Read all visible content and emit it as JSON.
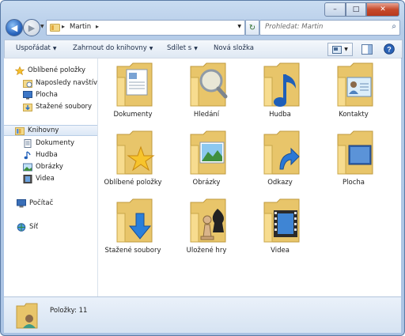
{
  "window": {
    "caption": {
      "minimize": "–",
      "maximize": "□",
      "close": "✕"
    }
  },
  "address": {
    "crumb": "Martin",
    "sep": "▸",
    "search_placeholder": "Prohledat: Martin"
  },
  "toolbar": {
    "organize": "Uspořádat",
    "include_library": "Zahrnout do knihovny",
    "share": "Sdílet s",
    "new_folder": "Nová složka"
  },
  "sidebar": {
    "favorites": "Oblíbené položky",
    "recent": "Naposledy navštíven",
    "desktop": "Plocha",
    "downloads": "Stažené soubory",
    "libraries": "Knihovny",
    "documents": "Dokumenty",
    "music": "Hudba",
    "pictures": "Obrázky",
    "videos": "Videa",
    "computer": "Počítač",
    "network": "Síť"
  },
  "folders": [
    {
      "label": "Dokumenty",
      "icon": "documents-overlay"
    },
    {
      "label": "Hledání",
      "icon": "magnifier-overlay"
    },
    {
      "label": "Hudba",
      "icon": "music-note-overlay"
    },
    {
      "label": "Kontakty",
      "icon": "contact-card-overlay"
    },
    {
      "label": "Oblíbené položky",
      "icon": "star-overlay"
    },
    {
      "label": "Obrázky",
      "icon": "landscape-overlay"
    },
    {
      "label": "Odkazy",
      "icon": "arrow-link-overlay"
    },
    {
      "label": "Plocha",
      "icon": "desktop-screen-overlay"
    },
    {
      "label": "Stažené soubory",
      "icon": "download-arrow-overlay"
    },
    {
      "label": "Uložené hry",
      "icon": "chess-pieces-overlay"
    },
    {
      "label": "Videa",
      "icon": "film-strip-overlay"
    }
  ],
  "status": {
    "items": "Položky: 11"
  },
  "colors": {
    "accent": "#2b67bf",
    "folder": "#f3d98a",
    "selection": "#dce8f6"
  }
}
